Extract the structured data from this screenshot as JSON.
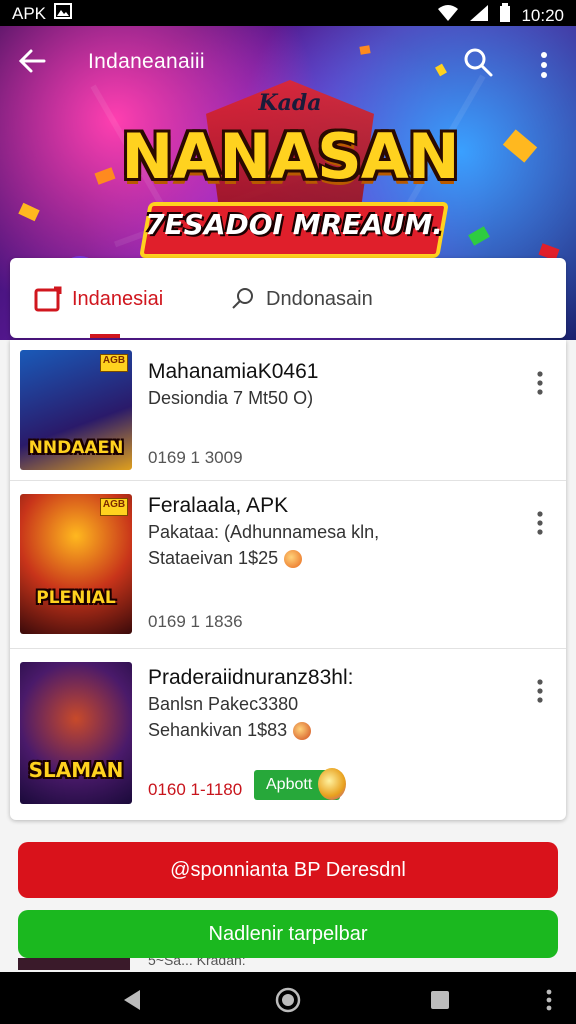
{
  "status_bar": {
    "app_label": "APK",
    "time": "10:20",
    "icons": [
      "image-icon",
      "wifi-icon",
      "signal-icon",
      "battery-icon"
    ]
  },
  "header": {
    "title": "Indaneanaiii",
    "back_icon": "arrow-left-icon",
    "search_icon": "search-icon",
    "more_icon": "more-vertical-icon"
  },
  "banner": {
    "small_text": "Kada",
    "big_text": "NANASAN",
    "ribbon_text": "7ESADOI MREAUM."
  },
  "tabs": [
    {
      "label": "Indanesiai",
      "icon": "tag-icon",
      "active": true
    },
    {
      "label": "Dndonasain",
      "icon": "search-icon",
      "active": false
    }
  ],
  "items": [
    {
      "title": "MahanamiaK0461",
      "subtitle": "Desiondia 7 Mt50 O)",
      "extra": "",
      "meta": "0169   1 3009",
      "thumb_title": "NNDAAEN",
      "thumb_corner": "AGB"
    },
    {
      "title": "Feralaala, APK",
      "subtitle": "Pakataa: (Adhunnamesa kln,",
      "extra": "Stataeivan 1$25",
      "meta": "0169   1 1836",
      "thumb_title": "PLENIAL",
      "thumb_corner": "AGB"
    },
    {
      "title": "Praderaiidnuranz83hl:",
      "subtitle": "Banlsn Pakec3380",
      "extra": "Sehankivan 1$83",
      "meta": "0160   1-1180",
      "thumb_title": "SLAMAN",
      "thumb_corner": "",
      "badge": "Apbott"
    }
  ],
  "buttons": {
    "primary": "@sponnianta BP Deresdnl",
    "secondary": "Nadlenir tarpelbar"
  },
  "peek_text": "5~Sa... Kradan:",
  "colors": {
    "accent_red": "#d9121b",
    "accent_green": "#1bb81f",
    "badge_green": "#27a83a",
    "logo_yellow": "#ffd21f"
  }
}
